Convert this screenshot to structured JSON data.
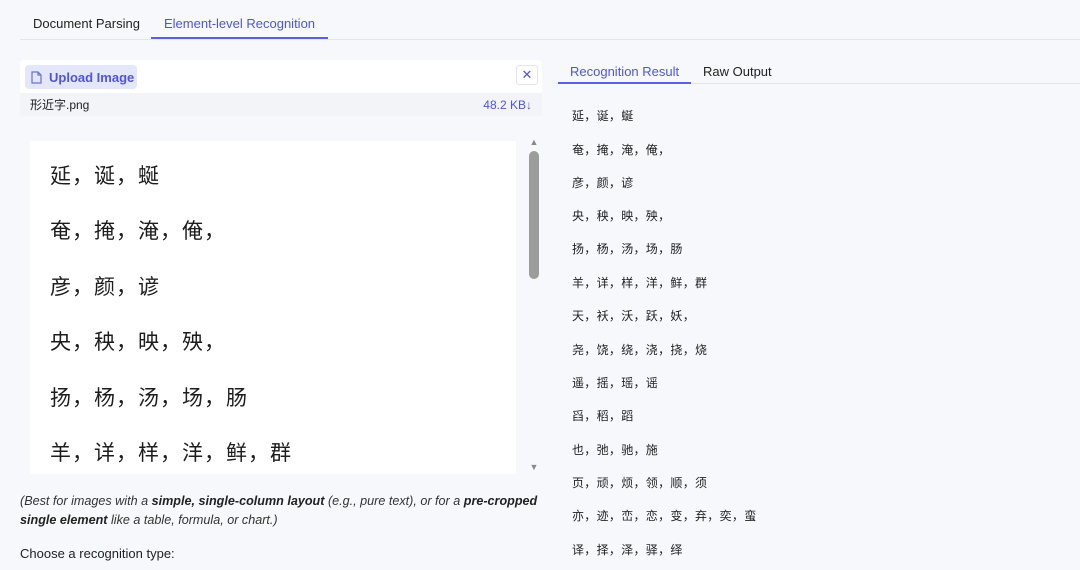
{
  "top_tabs": [
    {
      "label": "Document Parsing",
      "active": false
    },
    {
      "label": "Element-level Recognition",
      "active": true
    }
  ],
  "upload": {
    "button_label": "Upload Image",
    "close_symbol": "✕",
    "file_name": "形近字.png",
    "file_size": "48.2 KB",
    "download_symbol": "↓"
  },
  "preview_lines": [
    "延，诞，蜒",
    "奄，掩，淹，俺，",
    "彦，颜，谚",
    "央，秧，映，殃，",
    "扬，杨，汤，场，肠",
    "羊，详，样，洋，鲜，群"
  ],
  "note": {
    "part1": "(Best for images with a ",
    "bold1": "simple, single-column layout",
    "part2": " (e.g., pure text), or for a ",
    "bold2": "pre-cropped single element",
    "part3": " like a table, formula, or chart.)"
  },
  "choose_label": "Choose a recognition type:",
  "right_tabs": [
    {
      "label": "Recognition Result",
      "active": true
    },
    {
      "label": "Raw Output",
      "active": false
    }
  ],
  "result_lines": [
    "延，诞，蜒",
    "奄，掩，淹，俺，",
    "彦，颜，谚",
    "央，秧，映，殃，",
    "扬，杨，汤，场，肠",
    "羊，详，样，洋，鲜，群",
    "天，袄，沃，跃，妖，",
    "尧，饶，绕，浇，挠，烧",
    "遥，摇，瑶，谣",
    "舀，稻，蹈",
    "也，弛，驰，施",
    "页，顽，烦，领，顺，须",
    "亦，迹，峦，恋，变，弃，奕，蛮",
    "译，择，泽，驿，绎"
  ],
  "colors": {
    "accent": "#4f55d8",
    "accent_bg": "#e4e6fa",
    "scroll_thumb": "#9c9c9c"
  },
  "icons": [
    "file-icon",
    "close-icon",
    "download-icon",
    "scroll-up-icon",
    "scroll-down-icon"
  ]
}
